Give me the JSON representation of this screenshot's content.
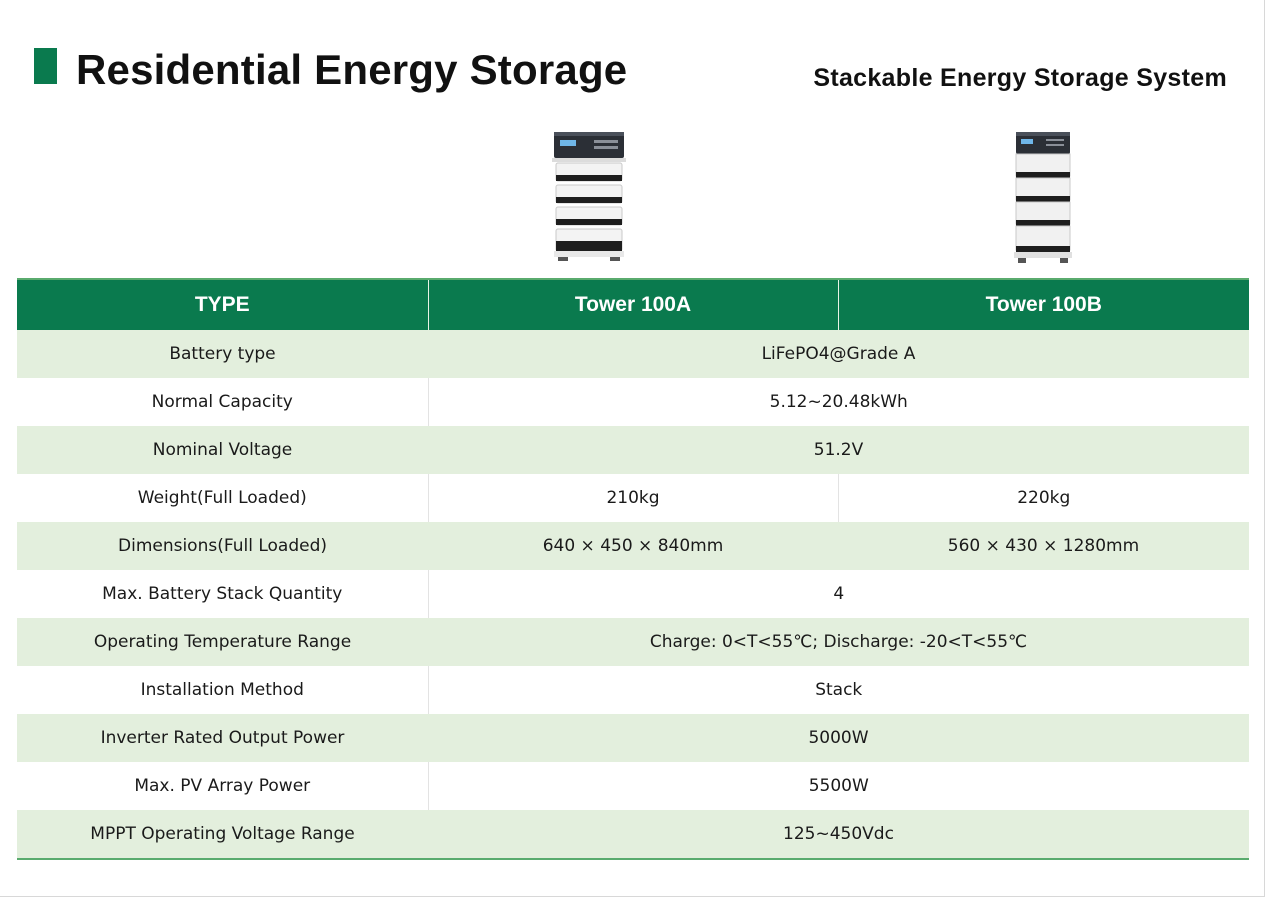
{
  "header": {
    "title": "Residential Energy Storage",
    "subtitle": "Stackable Energy Storage System"
  },
  "colors": {
    "accent_green": "#0a7a4e",
    "row_shade": "#e3efdd",
    "rule_green": "#5aab6e"
  },
  "images": [
    {
      "name": "tower-100a-product-image",
      "depicts": "stacked battery tower with inverter on top (4 modules)"
    },
    {
      "name": "tower-100b-product-image",
      "depicts": "slim stacked battery tower with inverter on top (4 modules)"
    }
  ],
  "table": {
    "headers": [
      "TYPE",
      "Tower 100A",
      "Tower 100B"
    ],
    "rows": [
      {
        "label": "Battery type",
        "value": "LiFePO4@Grade A"
      },
      {
        "label": "Normal Capacity",
        "value": "5.12~20.48kWh"
      },
      {
        "label": "Nominal Voltage",
        "value": "51.2V"
      },
      {
        "label": "Weight(Full Loaded)",
        "a": "210kg",
        "b": "220kg"
      },
      {
        "label": "Dimensions(Full Loaded)",
        "a": "640 × 450 × 840mm",
        "b": "560 × 430 × 1280mm"
      },
      {
        "label": "Max. Battery Stack Quantity",
        "value": "4"
      },
      {
        "label": "Operating Temperature Range",
        "value": "Charge: 0<T<55℃; Discharge: -20<T<55℃"
      },
      {
        "label": "Installation Method",
        "value": "Stack"
      },
      {
        "label": "Inverter Rated Output Power",
        "value": "5000W"
      },
      {
        "label": "Max. PV Array Power",
        "value": "5500W"
      },
      {
        "label": "MPPT Operating Voltage Range",
        "value": "125~450Vdc"
      }
    ]
  }
}
